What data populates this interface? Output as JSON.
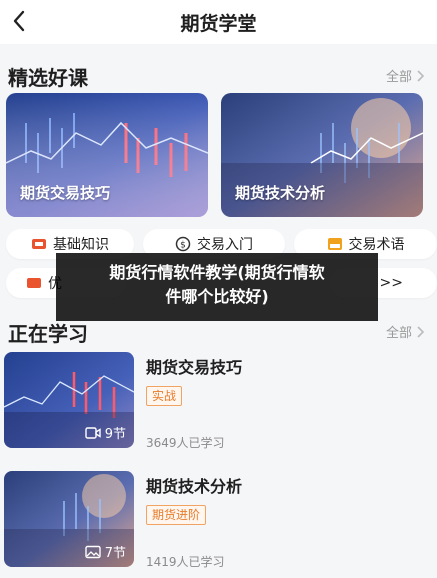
{
  "header": {
    "title": "期货学堂"
  },
  "featured": {
    "title": "精选好课",
    "more": "全部",
    "cards": [
      {
        "label": "期货交易技巧"
      },
      {
        "label": "期货技术分析"
      }
    ]
  },
  "categories": [
    {
      "label": "基础知识",
      "icon": "basics-badge-icon"
    },
    {
      "label": "交易入门",
      "icon": "clock-dollar-icon"
    },
    {
      "label": "交易术语",
      "icon": "terms-badge-icon"
    },
    {
      "label": "优",
      "icon": "quality-badge-icon"
    },
    {
      "label": ">>",
      "icon": ""
    }
  ],
  "overlay": {
    "line1": "期货行情软件教学(期货行情软",
    "line2": "件哪个比较好)"
  },
  "learning": {
    "title": "正在学习",
    "more": "全部",
    "courses": [
      {
        "title": "期货交易技巧",
        "tag": "实战",
        "count": "9节",
        "count_icon": "video-icon",
        "learners": "3649人已学习"
      },
      {
        "title": "期货技术分析",
        "tag": "期货进阶",
        "count": "7节",
        "count_icon": "image-icon",
        "learners": "1419人已学习"
      }
    ]
  },
  "colors": {
    "tag_border": "#f1a363",
    "tag_text": "#e87b2a",
    "overlay_bg": "#000000"
  }
}
